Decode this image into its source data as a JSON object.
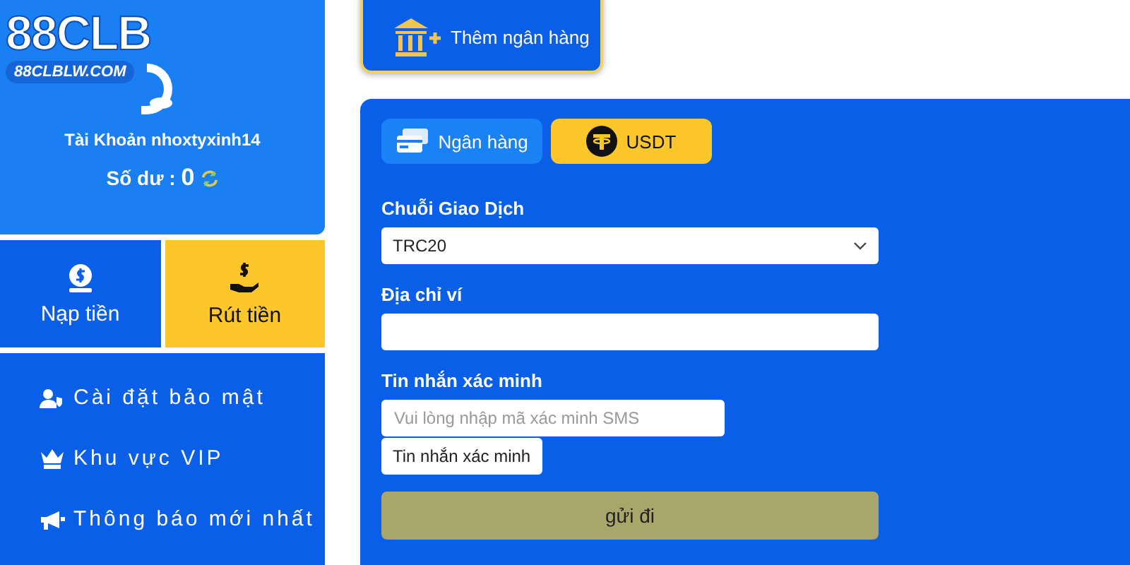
{
  "sidebar": {
    "logo": {
      "brand": "88CLB",
      "domain": "88CLBLW.COM"
    },
    "account_label": "Tài Khoản",
    "username": "nhoxtyxinh14",
    "balance_label": "Số dư :",
    "balance": "0",
    "actions": [
      {
        "kind": "deposit",
        "label": "Nạp tiền",
        "selected": false
      },
      {
        "kind": "withdraw",
        "label": "Rút tiền",
        "selected": true
      }
    ],
    "menu": [
      {
        "kind": "security",
        "label": "Cài đặt bảo mật"
      },
      {
        "kind": "vip",
        "label": "Khu vực VIP"
      },
      {
        "kind": "notice",
        "label": "Thông báo mới nhất"
      }
    ]
  },
  "add_bank_button": "Thêm ngân hàng",
  "form": {
    "tabs": [
      {
        "kind": "bank",
        "label": "Ngân hàng",
        "selected": false
      },
      {
        "kind": "usdt",
        "label": "USDT",
        "selected": true
      }
    ],
    "chain_label": "Chuỗi Giao Dịch",
    "chain_value": "TRC20",
    "wallet_label": "Địa chỉ ví",
    "sms_label": "Tin nhắn xác minh",
    "sms_placeholder": "Vui lòng nhập mã xác minh SMS",
    "sms_button": "Tin nhắn xác minh",
    "submit": "gửi đi"
  }
}
